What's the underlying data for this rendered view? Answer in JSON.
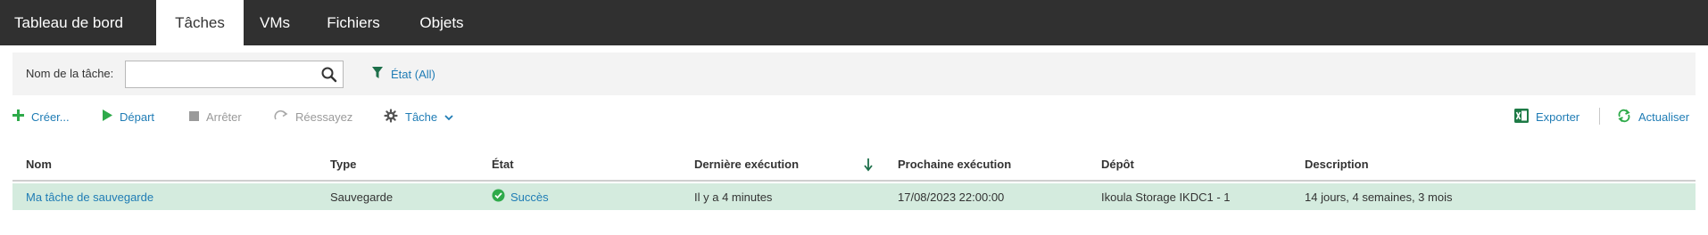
{
  "nav": {
    "tabs": [
      {
        "label": "Tableau de bord"
      },
      {
        "label": "Tâches",
        "active": true
      },
      {
        "label": "VMs"
      },
      {
        "label": "Fichiers"
      },
      {
        "label": "Objets"
      }
    ]
  },
  "filter": {
    "name_label": "Nom de la tâche:",
    "name_value": "",
    "state_label": "État (All)"
  },
  "toolbar": {
    "create": "Créer...",
    "start": "Départ",
    "stop": "Arrêter",
    "retry": "Réessayez",
    "task": "Tâche",
    "export": "Exporter",
    "refresh": "Actualiser"
  },
  "table": {
    "columns": [
      "Nom",
      "Type",
      "État",
      "Dernière exécution",
      "Prochaine exécution",
      "Dépôt",
      "Description"
    ],
    "sort_column": "Dernière exécution",
    "sort_direction": "descending",
    "rows": [
      {
        "name": "Ma tâche de sauvegarde",
        "type": "Sauvegarde",
        "state": "Succès",
        "last_run": "Il y a 4 minutes",
        "next_run": "17/08/2023 22:00:00",
        "repository": "Ikoula Storage IKDC1 - 1",
        "description": "14 jours, 4 semaines, 3 mois"
      }
    ]
  },
  "colors": {
    "nav_bg": "#303030",
    "link": "#1f7cb5",
    "success": "#2eaa4a",
    "selected_row": "#d4ebde",
    "excel_green": "#1d7a45"
  },
  "icons": {
    "search": "search-icon",
    "filter": "funnel-icon",
    "create": "plus-icon",
    "start": "play-icon",
    "stop": "stop-icon",
    "retry": "retry-icon",
    "task": "gear-icon",
    "export": "excel-icon",
    "refresh": "refresh-icon",
    "sort": "arrow-down-icon",
    "success": "check-circle-icon"
  }
}
